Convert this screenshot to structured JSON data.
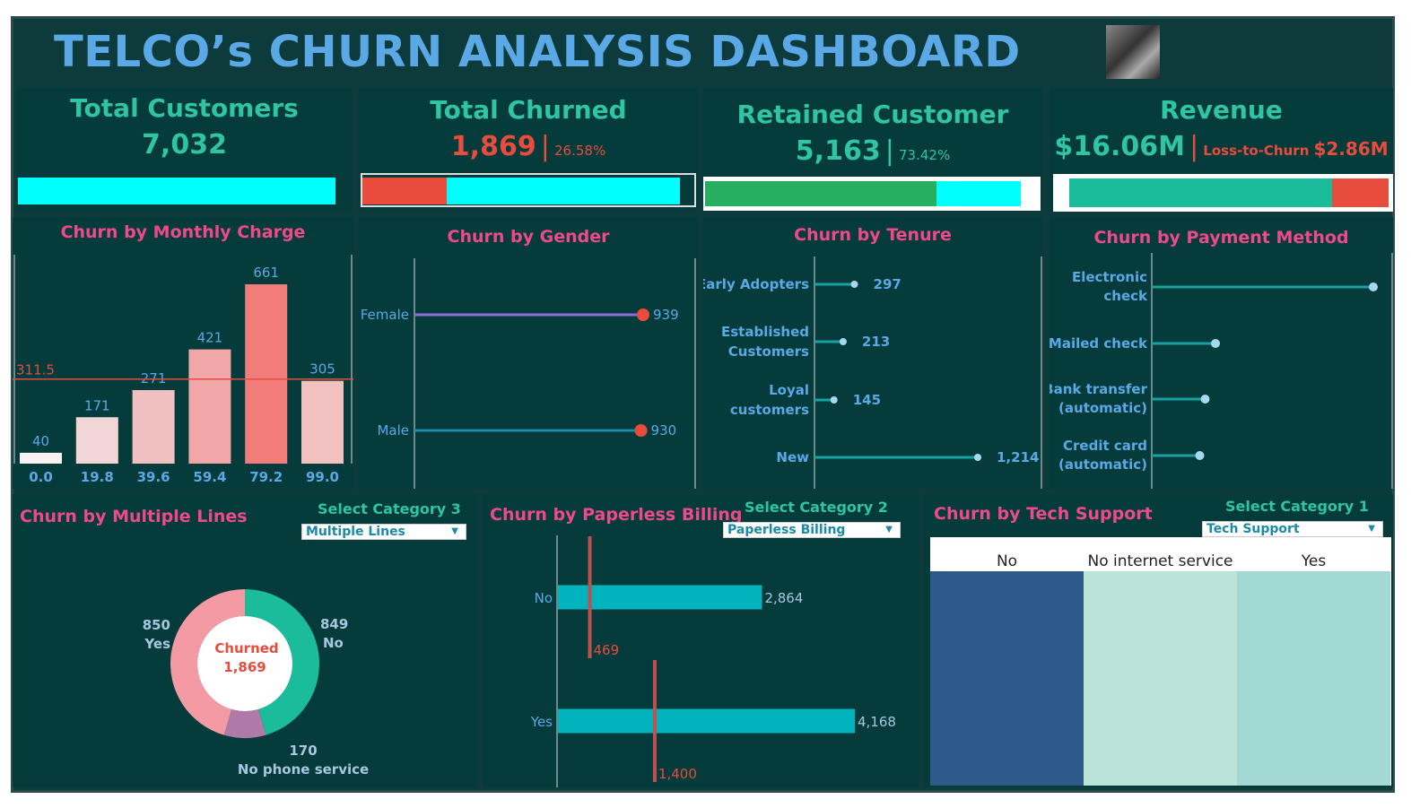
{
  "header": {
    "title": "TELCO’s CHURN ANALYSIS DASHBOARD"
  },
  "kpis": {
    "total_customers": {
      "label": "Total Customers",
      "value": "7,032"
    },
    "total_churned": {
      "label": "Total Churned",
      "value": "1,869",
      "sep": "|",
      "pct": "26.58%",
      "share": 0.2658
    },
    "retained": {
      "label": "Retained Customer",
      "value": "5,163",
      "sep": "|",
      "pct": "73.42%",
      "share": 0.7342
    },
    "revenue": {
      "label": "Revenue",
      "value": "$16.06M",
      "sep": "|",
      "loss_label": "Loss-to-Churn",
      "loss_value": "$2.86M",
      "loss_share": 0.178
    }
  },
  "colors": {
    "bg": "#053b3b",
    "cyan": "#00ffff",
    "red": "#e74c3c",
    "green": "#27ae60",
    "teal": "#1abc9c",
    "pink": "#ee4a8a",
    "blue": "#5aa9e6"
  },
  "charts": {
    "monthly": {
      "title": "Churn by Monthly Charge",
      "ref_label": "311.5"
    },
    "gender": {
      "title": "Churn by Gender"
    },
    "tenure": {
      "title": "Churn by Tenure"
    },
    "payment": {
      "title": "Churn by Payment Method"
    },
    "multiple_lines": {
      "title": "Churn by Multiple Lines",
      "select_label": "Select Category 3",
      "select_value": "Multiple Lines",
      "center_label": "Churned",
      "center_value": "1,869"
    },
    "paperless": {
      "title": "Churn by Paperless Billing",
      "select_label": "Select Category 2",
      "select_value": "Paperless Billing"
    },
    "tech": {
      "title": "Churn by Tech Support",
      "select_label": "Select Category 1",
      "select_value": "Tech Support"
    }
  },
  "chart_data": [
    {
      "type": "bar",
      "title": "Churn by Monthly Charge",
      "categories": [
        "0.0",
        "19.8",
        "39.6",
        "59.4",
        "79.2",
        "99.0"
      ],
      "values": [
        40,
        171,
        271,
        421,
        661,
        305
      ],
      "reference_line": 311.5,
      "colors": [
        "#f8f1f1",
        "#f1d6d6",
        "#f0c0c0",
        "#f1a7a7",
        "#f07d7a",
        "#f1c0bf"
      ]
    },
    {
      "type": "scatter",
      "title": "Churn by Gender",
      "categories": [
        "Female",
        "Male"
      ],
      "values": [
        939,
        930
      ],
      "labels": [
        "939",
        "930"
      ],
      "line_colors": [
        "#8e6bd8",
        "#1a8aa8"
      ]
    },
    {
      "type": "scatter",
      "title": "Churn by Tenure",
      "categories": [
        "Early Adopters",
        "Established Customers",
        "Loyal customers",
        "New"
      ],
      "label_lines": [
        [
          "Early Adopters"
        ],
        [
          "Established",
          "Customers"
        ],
        [
          "Loyal",
          "customers"
        ],
        [
          "New"
        ]
      ],
      "values": [
        297,
        213,
        145,
        1214
      ],
      "labels": [
        "297",
        "213",
        "145",
        "1,214"
      ]
    },
    {
      "type": "scatter",
      "title": "Churn by Payment Method",
      "categories": [
        "Electronic check",
        "Mailed check",
        "Bank transfer (automatic)",
        "Credit card (automatic)"
      ],
      "label_lines": [
        [
          "Electronic",
          "check"
        ],
        [
          "Mailed check"
        ],
        [
          "Bank transfer",
          "(automatic)"
        ],
        [
          "Credit card",
          "(automatic)"
        ]
      ],
      "values": [
        1071,
        308,
        258,
        232
      ]
    },
    {
      "type": "pie",
      "title": "Churn by Multiple Lines",
      "series": [
        {
          "name": "No",
          "value": 849,
          "label": "849",
          "color": "#1abc9c"
        },
        {
          "name": "No phone service",
          "value": 170,
          "label": "170",
          "color": "#b07aa8"
        },
        {
          "name": "Yes",
          "value": 850,
          "label": "850",
          "color": "#f49aa5"
        }
      ]
    },
    {
      "type": "bar",
      "title": "Churn by Paperless Billing",
      "categories": [
        "No",
        "Yes"
      ],
      "values": [
        2864,
        4168
      ],
      "value_labels": [
        "2,864",
        "4,168"
      ],
      "churn": [
        469,
        1400
      ],
      "churn_labels": [
        "469",
        "1,400"
      ]
    },
    {
      "type": "heatmap",
      "title": "Churn by Tech Support",
      "categories": [
        "No",
        "No internet service",
        "Yes"
      ],
      "colors": [
        "#2d5a88",
        "#bce3d8",
        "#a3d9d3"
      ]
    }
  ]
}
